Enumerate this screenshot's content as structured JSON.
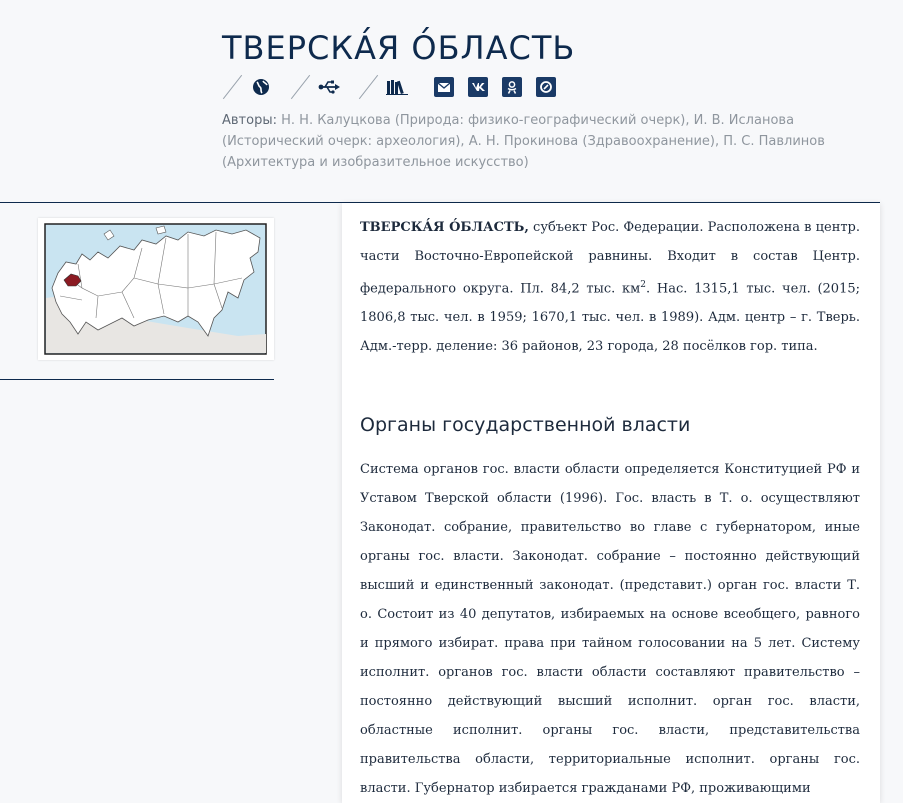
{
  "header": {
    "title": "ТВЕРСКА́Я О́БЛАСТЬ",
    "authors_label": "Авторы:",
    "authors_text": "Н. Н. Калуцкова (Природа: физико-географический очерк), И. В. Исланова (Исторический очерк: археология), А. Н. Прокинова (Здравоохранение), П. С. Павлинов (Архитектура и изобразительное искусство)"
  },
  "toolbar": {
    "icons": [
      "globe-icon",
      "usb-icon",
      "books-icon"
    ]
  },
  "share": {
    "icons": [
      "email-icon",
      "vk-icon",
      "odnoklassniki-icon",
      "link-icon"
    ]
  },
  "map": {
    "highlight_color": "#8b1a22"
  },
  "article": {
    "lead_term": "ТВЕРСКА́Я О́БЛАСТЬ,",
    "intro_1": " субъект Рос. Федерации. Расположена в центр. части Восточно-Европейской равнины. Входит в состав Центр. федерального округа. Пл. 84,2 тыс. км",
    "intro_sup": "2",
    "intro_2": ". Нас. 1315,1 тыс. чел. (2015; 1806,8 тыс. чел. в 1959; 1670,1 тыс. чел. в 1989). Адм. центр – г. Тверь. Адм.-терр. деление: 36 районов, 23 города, 28 посёлков гор. типа.",
    "section_title": "Органы государственной власти",
    "body": "Система органов гос. власти области определяется Конституцией РФ и Уставом Тверской области (1996). Гос. власть в Т. о. осуществляют Законодат. собрание, правительство во главе с губернатором, иные органы гос. власти. Законодат. собрание – постоянно действующий высший и единственный законодат. (представит.) орган гос. власти Т. о. Состоит из 40 депутатов, избираемых на основе всеобщего, равного и прямого избират. права при тайном голосовании на 5 лет. Систему исполнит. органов гос. власти области составляют правительство – постоянно действующий высший исполнит. орган гос. власти, областные исполнит. органы гос. власти, представительства правительства области, территориальные исполнит. органы гос. власти. Губернатор избирается гражданами РФ, проживающими"
  },
  "colors": {
    "accent": "#0e2a4d",
    "share_bg": "#1a3a66",
    "muted": "#8f969e"
  }
}
